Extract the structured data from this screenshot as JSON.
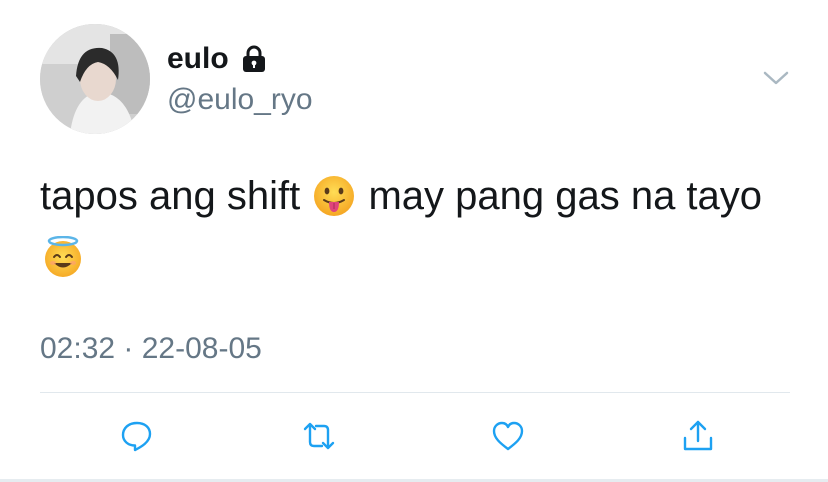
{
  "author": {
    "display_name": "eulo",
    "handle": "@eulo_ryo",
    "protected": true
  },
  "tweet": {
    "text_part1": "tapos ang shift",
    "emoji1": "face-with-tongue",
    "text_part2": "may pang gas na tayo",
    "emoji2": "smiling-face-with-halo"
  },
  "timestamp": "02:32 · 22-08-05",
  "actions": [
    "reply-icon",
    "retweet-icon",
    "like-icon",
    "share-icon"
  ],
  "colors": {
    "text": "#14171a",
    "secondary": "#657786",
    "icon": "#1da1f2",
    "divider": "#e1e8ed"
  }
}
